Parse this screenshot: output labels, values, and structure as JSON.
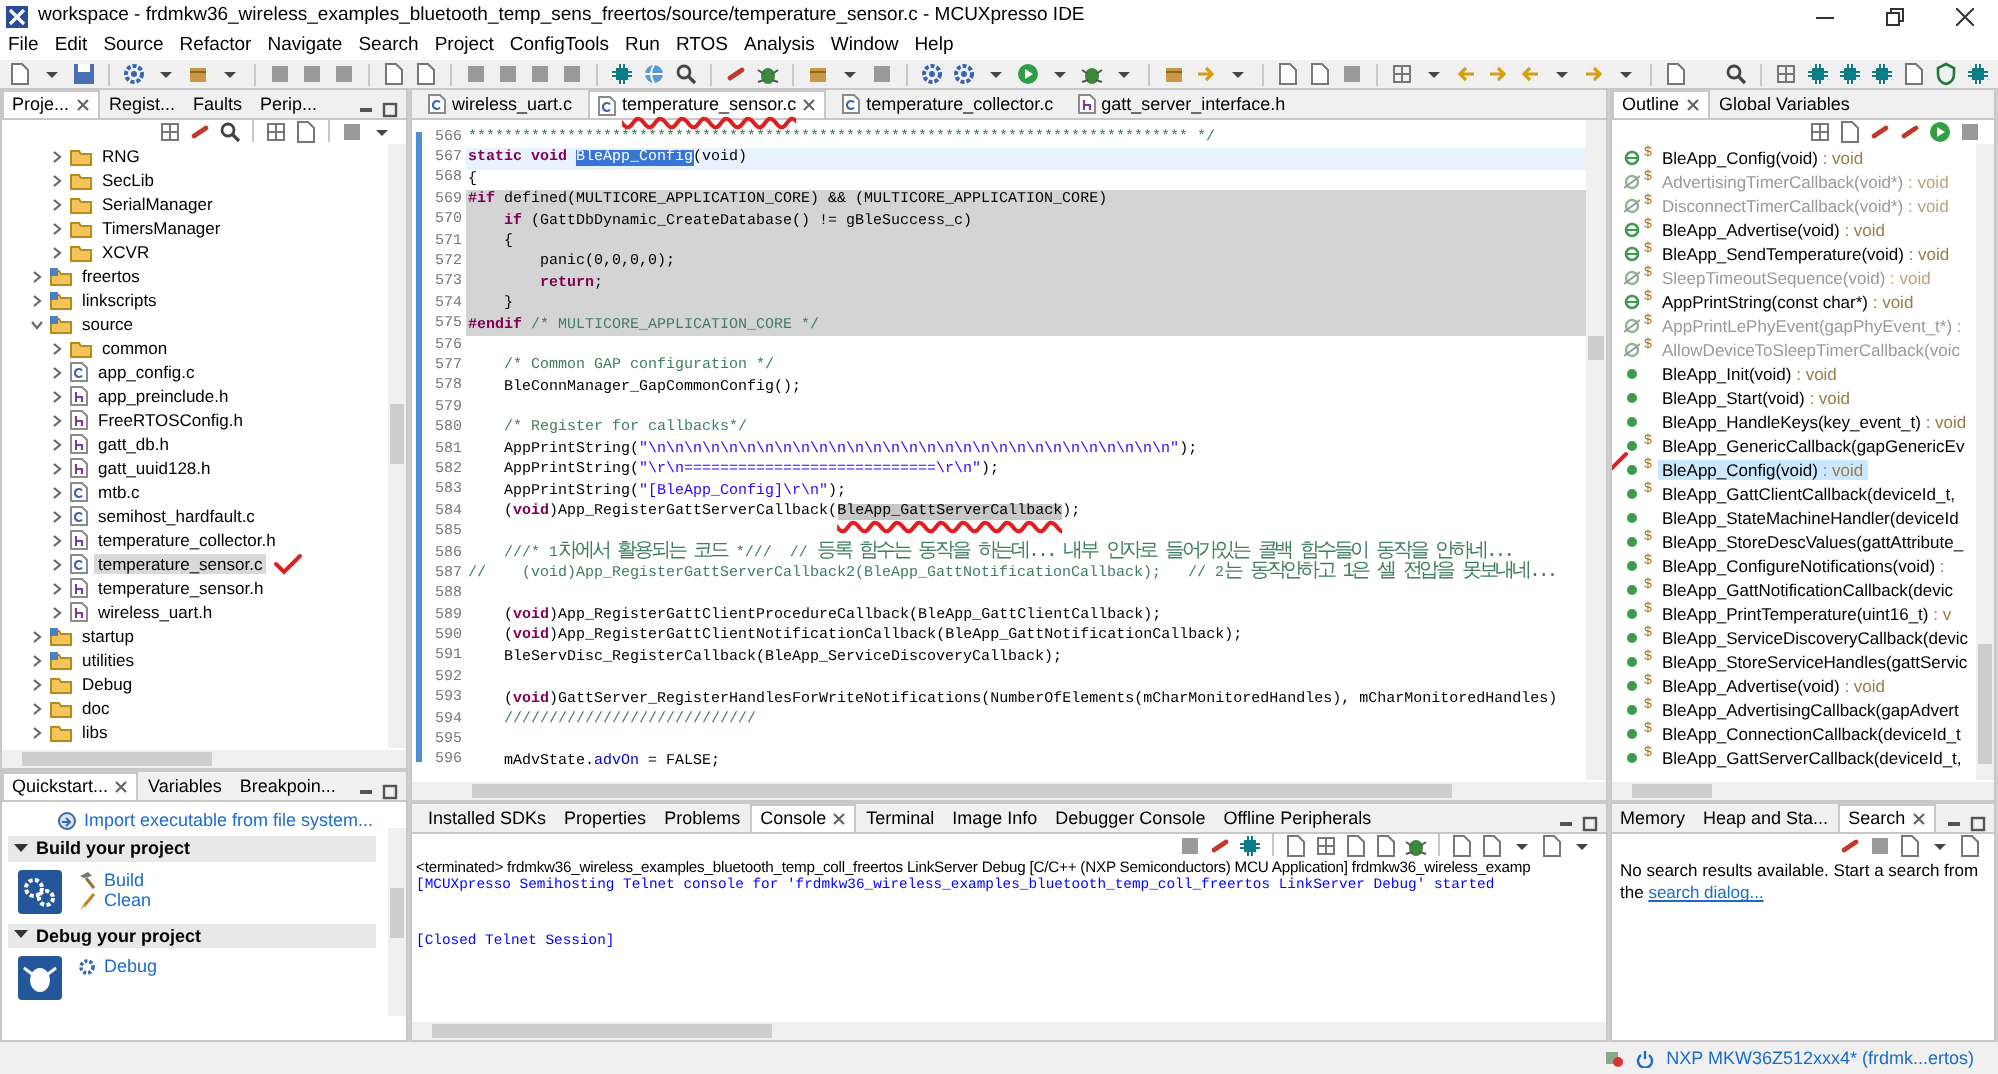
{
  "window": {
    "title": "workspace - frdmkw36_wireless_examples_bluetooth_temp_sens_freertos/source/temperature_sensor.c - MCUXpresso IDE"
  },
  "menu": [
    "File",
    "Edit",
    "Source",
    "Refactor",
    "Navigate",
    "Search",
    "Project",
    "ConfigTools",
    "Run",
    "RTOS",
    "Analysis",
    "Window",
    "Help"
  ],
  "project_panel": {
    "tabs": [
      {
        "label": "Proje...",
        "selected": true
      },
      {
        "label": "Regist...",
        "selected": false
      },
      {
        "label": "Faults",
        "selected": false
      },
      {
        "label": "Perip...",
        "selected": false
      }
    ],
    "tree": {
      "continued_children": [
        {
          "label": "RNG",
          "kind": "folder",
          "expanded": false,
          "selected": false
        },
        {
          "label": "SecLib",
          "kind": "folder",
          "expanded": false,
          "selected": false
        },
        {
          "label": "SerialManager",
          "kind": "folder",
          "expanded": false,
          "selected": false
        },
        {
          "label": "TimersManager",
          "kind": "folder",
          "expanded": false,
          "selected": false
        },
        {
          "label": "XCVR",
          "kind": "folder",
          "expanded": false,
          "selected": false
        }
      ],
      "items": [
        {
          "label": "freertos",
          "kind": "source-folder",
          "expanded": false,
          "selected": false
        },
        {
          "label": "linkscripts",
          "kind": "source-folder",
          "expanded": false,
          "selected": false
        },
        {
          "label": "source",
          "kind": "source-folder",
          "expanded": true,
          "selected": false,
          "children": [
            {
              "label": "common",
              "kind": "folder",
              "expanded": false,
              "selected": false
            },
            {
              "label": "app_config.c",
              "kind": "c-file",
              "expanded": false,
              "selected": false
            },
            {
              "label": "app_preinclude.h",
              "kind": "h-file",
              "expanded": false,
              "selected": false
            },
            {
              "label": "FreeRTOSConfig.h",
              "kind": "h-file",
              "expanded": false,
              "selected": false
            },
            {
              "label": "gatt_db.h",
              "kind": "h-file",
              "expanded": false,
              "selected": false
            },
            {
              "label": "gatt_uuid128.h",
              "kind": "h-file",
              "expanded": false,
              "selected": false
            },
            {
              "label": "mtb.c",
              "kind": "c-file",
              "expanded": false,
              "selected": false
            },
            {
              "label": "semihost_hardfault.c",
              "kind": "c-file",
              "expanded": false,
              "selected": false
            },
            {
              "label": "temperature_collector.h",
              "kind": "h-file",
              "expanded": false,
              "selected": false
            },
            {
              "label": "temperature_sensor.c",
              "kind": "c-file",
              "expanded": false,
              "selected": true,
              "annotated": true
            },
            {
              "label": "temperature_sensor.h",
              "kind": "h-file",
              "expanded": false,
              "selected": false
            },
            {
              "label": "wireless_uart.h",
              "kind": "h-file",
              "expanded": false,
              "selected": false
            }
          ]
        },
        {
          "label": "startup",
          "kind": "source-folder",
          "expanded": false,
          "selected": false
        },
        {
          "label": "utilities",
          "kind": "source-folder",
          "expanded": false,
          "selected": false
        },
        {
          "label": "Debug",
          "kind": "folder",
          "expanded": false,
          "selected": false
        },
        {
          "label": "doc",
          "kind": "folder",
          "expanded": false,
          "selected": false
        },
        {
          "label": "libs",
          "kind": "folder",
          "expanded": false,
          "selected": false
        }
      ]
    }
  },
  "quickstart_panel": {
    "tabs": [
      {
        "label": "Quickstart...",
        "selected": true
      },
      {
        "label": "Variables",
        "selected": false
      },
      {
        "label": "Breakpoin...",
        "selected": false
      }
    ],
    "import_link": "Import executable from file system...",
    "sections": [
      {
        "title": "Build your project",
        "expanded": true,
        "links": [
          "Build",
          "Clean"
        ]
      },
      {
        "title": "Debug your project",
        "expanded": true,
        "links": [
          "Debug"
        ]
      }
    ]
  },
  "editor": {
    "tabs": [
      {
        "label": "wireless_uart.c",
        "kind": "c-file",
        "selected": false
      },
      {
        "label": "temperature_sensor.c",
        "kind": "c-file",
        "selected": true,
        "annotated": true
      },
      {
        "label": "temperature_collector.c",
        "kind": "c-file",
        "selected": false
      },
      {
        "label": "gatt_server_interface.h",
        "kind": "h-file",
        "selected": false
      }
    ],
    "lines": [
      {
        "n": "566",
        "kind": "normal",
        "parts": [
          {
            "kind": "comment",
            "text": "******************************************************************************** */"
          }
        ]
      },
      {
        "n": "567",
        "kind": "current",
        "parts": [
          {
            "kind": "keyword",
            "text": "static void "
          },
          {
            "kind": "selection",
            "text": "BleApp_Config"
          },
          {
            "kind": "plain",
            "text": "(void)"
          }
        ]
      },
      {
        "n": "568",
        "kind": "normal",
        "parts": [
          {
            "kind": "plain",
            "text": "{"
          }
        ]
      },
      {
        "n": "569",
        "kind": "inactive",
        "parts": [
          {
            "kind": "keyword",
            "text": "#if "
          },
          {
            "kind": "plain",
            "text": "defined(MULTICORE_APPLICATION_CORE) && (MULTICORE_APPLICATION_CORE)"
          }
        ]
      },
      {
        "n": "570",
        "kind": "inactive",
        "parts": [
          {
            "kind": "keyword",
            "text": "    if"
          },
          {
            "kind": "plain",
            "text": " (GattDbDynamic_CreateDatabase() != gBleSuccess_c)"
          }
        ]
      },
      {
        "n": "571",
        "kind": "inactive",
        "parts": [
          {
            "kind": "plain",
            "text": "    {"
          }
        ]
      },
      {
        "n": "572",
        "kind": "inactive",
        "parts": [
          {
            "kind": "plain",
            "text": "        panic(0,0,0,0);"
          }
        ]
      },
      {
        "n": "573",
        "kind": "inactive",
        "parts": [
          {
            "kind": "keyword",
            "text": "        return"
          },
          {
            "kind": "plain",
            "text": ";"
          }
        ]
      },
      {
        "n": "574",
        "kind": "inactive",
        "parts": [
          {
            "kind": "plain",
            "text": "    }"
          }
        ]
      },
      {
        "n": "575",
        "kind": "inactive",
        "parts": [
          {
            "kind": "keyword",
            "text": "#endif "
          },
          {
            "kind": "comment",
            "text": "/* MULTICORE_APPLICATION_CORE */"
          }
        ]
      },
      {
        "n": "576",
        "kind": "normal"
      },
      {
        "n": "577",
        "kind": "normal",
        "parts": [
          {
            "kind": "comment",
            "text": "    /* Common GAP configuration */"
          }
        ]
      },
      {
        "n": "578",
        "kind": "normal",
        "parts": [
          {
            "kind": "plain",
            "text": "    BleConnManager_GapCommonConfig();"
          }
        ]
      },
      {
        "n": "579",
        "kind": "normal"
      },
      {
        "n": "580",
        "kind": "normal",
        "parts": [
          {
            "kind": "comment",
            "text": "    /* Register for callbacks*/"
          }
        ]
      },
      {
        "n": "581",
        "kind": "normal",
        "parts": [
          {
            "kind": "plain",
            "text": "    AppPrintString("
          },
          {
            "kind": "string",
            "text": "\"\\n\\n\\n\\n\\n\\n\\n\\n\\n\\n\\n\\n\\n\\n\\n\\n\\n\\n\\n\\n\\n\\n\\n\\n\\n\\n\\n\\n\\n\""
          },
          {
            "kind": "plain",
            "text": ");"
          }
        ]
      },
      {
        "n": "582",
        "kind": "normal",
        "parts": [
          {
            "kind": "plain",
            "text": "    AppPrintString("
          },
          {
            "kind": "string",
            "text": "\"\\r\\n============================\\r\\n\""
          },
          {
            "kind": "plain",
            "text": ");"
          }
        ]
      },
      {
        "n": "583",
        "kind": "normal",
        "parts": [
          {
            "kind": "plain",
            "text": "    AppPrintString("
          },
          {
            "kind": "string",
            "text": "\"[BleApp_Config]\\r\\n\""
          },
          {
            "kind": "plain",
            "text": ");"
          }
        ]
      },
      {
        "n": "584",
        "kind": "normal",
        "parts": [
          {
            "kind": "plain",
            "text": "    ("
          },
          {
            "kind": "keyword",
            "text": "void"
          },
          {
            "kind": "plain",
            "text": ")App_RegisterGattServerCallback("
          },
          {
            "kind": "occurrence",
            "text": "BleApp_GattServerCallback",
            "annotated": true
          },
          {
            "kind": "plain",
            "text": ");"
          }
        ]
      },
      {
        "n": "585",
        "kind": "normal"
      },
      {
        "n": "586",
        "kind": "normal",
        "parts": [
          {
            "kind": "comment",
            "text": "    ///* 1"
          },
          {
            "kind": "hangul",
            "text": "차에서 활용되는 코드"
          },
          {
            "kind": "comment",
            "text": " *///  // "
          },
          {
            "kind": "hangul",
            "text": "등록 함수는 동작을 하는데... 내부 인자로 들어가있는 콜백 함수들이 동작을 안하네..."
          }
        ]
      },
      {
        "n": "587",
        "kind": "normal",
        "parts": [
          {
            "kind": "comment",
            "text": "//    (void)App_RegisterGattServerCallback2(BleApp_GattNotificationCallback);   // 2"
          },
          {
            "kind": "hangul",
            "text": "는 동작안하고 1은 셀 전압을 못보내네..."
          }
        ]
      },
      {
        "n": "588",
        "kind": "normal"
      },
      {
        "n": "589",
        "kind": "normal",
        "parts": [
          {
            "kind": "plain",
            "text": "    ("
          },
          {
            "kind": "keyword",
            "text": "void"
          },
          {
            "kind": "plain",
            "text": ")App_RegisterGattClientProcedureCallback(BleApp_GattClientCallback);"
          }
        ]
      },
      {
        "n": "590",
        "kind": "normal",
        "parts": [
          {
            "kind": "plain",
            "text": "    ("
          },
          {
            "kind": "keyword",
            "text": "void"
          },
          {
            "kind": "plain",
            "text": ")App_RegisterGattClientNotificationCallback(BleApp_GattNotificationCallback);"
          }
        ]
      },
      {
        "n": "591",
        "kind": "normal",
        "parts": [
          {
            "kind": "plain",
            "text": "    BleServDisc_RegisterCallback(BleApp_ServiceDiscoveryCallback);"
          }
        ]
      },
      {
        "n": "592",
        "kind": "normal"
      },
      {
        "n": "593",
        "kind": "normal",
        "parts": [
          {
            "kind": "plain",
            "text": "    ("
          },
          {
            "kind": "keyword",
            "text": "void"
          },
          {
            "kind": "plain",
            "text": ")GattServer_RegisterHandlesForWriteNotifications(NumberOfElements(mCharMonitoredHandles), mCharMonitoredHandles)"
          }
        ]
      },
      {
        "n": "594",
        "kind": "normal",
        "parts": [
          {
            "kind": "comment",
            "text": "    ////////////////////////////"
          }
        ]
      },
      {
        "n": "595",
        "kind": "normal"
      },
      {
        "n": "596",
        "kind": "normal",
        "parts": [
          {
            "kind": "plain",
            "text": "    mAdvState."
          },
          {
            "kind": "field",
            "text": "advOn"
          },
          {
            "kind": "plain",
            "text": " = FALSE;"
          }
        ]
      }
    ]
  },
  "console_panel": {
    "tabs": [
      {
        "label": "Installed SDKs",
        "selected": false
      },
      {
        "label": "Properties",
        "selected": false
      },
      {
        "label": "Problems",
        "selected": false
      },
      {
        "label": "Console",
        "selected": true
      },
      {
        "label": "Terminal",
        "selected": false
      },
      {
        "label": "Image Info",
        "selected": false
      },
      {
        "label": "Debugger Console",
        "selected": false
      },
      {
        "label": "Offline Peripherals",
        "selected": false
      }
    ],
    "header": "<terminated> frdmkw36_wireless_examples_bluetooth_temp_coll_freertos LinkServer Debug [C/C++ (NXP Semiconductors) MCU Application] frdmkw36_wireless_examp",
    "lines": [
      "[MCUXpresso Semihosting Telnet console for 'frdmkw36_wireless_examples_bluetooth_temp_coll_freertos LinkServer Debug' started",
      "[Closed Telnet Session]"
    ]
  },
  "outline_panel": {
    "tabs": [
      {
        "label": "Outline",
        "selected": true
      },
      {
        "label": "Global Variables",
        "selected": false
      }
    ],
    "items": [
      {
        "kind": "method",
        "static": "$",
        "name": "BleApp_Config(void)",
        "type": " : void",
        "dimmed": false,
        "selected": false
      },
      {
        "kind": "hidden",
        "static": "$",
        "name": "AdvertisingTimerCallback(void*)",
        "type": " : void",
        "dimmed": true,
        "selected": false
      },
      {
        "kind": "hidden",
        "static": "$",
        "name": "DisconnectTimerCallback(void*)",
        "type": " : void",
        "dimmed": true,
        "selected": false
      },
      {
        "kind": "method",
        "static": "$",
        "name": "BleApp_Advertise(void)",
        "type": " : void",
        "dimmed": false,
        "selected": false
      },
      {
        "kind": "method",
        "static": "$",
        "name": "BleApp_SendTemperature(void)",
        "type": " : void",
        "dimmed": false,
        "selected": false
      },
      {
        "kind": "hidden",
        "static": "$",
        "name": "SleepTimeoutSequence(void)",
        "type": " : void",
        "dimmed": true,
        "selected": false
      },
      {
        "kind": "method",
        "static": "$",
        "name": "AppPrintString(const char*)",
        "type": " : void",
        "dimmed": false,
        "selected": false
      },
      {
        "kind": "hidden",
        "static": "$",
        "name": "AppPrintLePhyEvent(gapPhyEvent_t*)",
        "type": " :",
        "dimmed": true,
        "selected": false
      },
      {
        "kind": "hidden",
        "static": "$",
        "name": "AllowDeviceToSleepTimerCallback(voic",
        "dimmed": true,
        "selected": false
      },
      {
        "kind": "dot",
        "name": "BleApp_Init(void)",
        "type": " : void",
        "dimmed": false,
        "selected": false
      },
      {
        "kind": "dot",
        "name": "BleApp_Start(void)",
        "type": " : void",
        "dimmed": false,
        "selected": false
      },
      {
        "kind": "dot",
        "name": "BleApp_HandleKeys(key_event_t)",
        "type": " : void",
        "dimmed": false,
        "selected": false
      },
      {
        "kind": "dot",
        "static": "$",
        "name": "BleApp_GenericCallback(gapGenericEv",
        "dimmed": false,
        "selected": false
      },
      {
        "kind": "dot",
        "static": "$",
        "name": "BleApp_Config(void)",
        "type": " : void",
        "dimmed": false,
        "selected": true,
        "annotated": true
      },
      {
        "kind": "dot",
        "static": "$",
        "name": "BleApp_GattClientCallback(deviceId_t,",
        "dimmed": false,
        "selected": false
      },
      {
        "kind": "dot",
        "name": "BleApp_StateMachineHandler(deviceId",
        "dimmed": false,
        "selected": false
      },
      {
        "kind": "dot",
        "static": "$",
        "name": "BleApp_StoreDescValues(gattAttribute_",
        "dimmed": false,
        "selected": false
      },
      {
        "kind": "dot",
        "static": "$",
        "name": "BleApp_ConfigureNotifications(void)",
        "type": " :",
        "dimmed": false,
        "selected": false
      },
      {
        "kind": "dot",
        "static": "$",
        "name": "BleApp_GattNotificationCallback(devic",
        "dimmed": false,
        "selected": false
      },
      {
        "kind": "dot",
        "static": "$",
        "name": "BleApp_PrintTemperature(uint16_t)",
        "type": " : v",
        "dimmed": false,
        "selected": false
      },
      {
        "kind": "dot",
        "static": "$",
        "name": "BleApp_ServiceDiscoveryCallback(devic",
        "dimmed": false,
        "selected": false
      },
      {
        "kind": "dot",
        "static": "$",
        "name": "BleApp_StoreServiceHandles(gattServic",
        "dimmed": false,
        "selected": false
      },
      {
        "kind": "dot",
        "static": "$",
        "name": "BleApp_Advertise(void)",
        "type": " : void",
        "dimmed": false,
        "selected": false
      },
      {
        "kind": "dot",
        "static": "$",
        "name": "BleApp_AdvertisingCallback(gapAdvert",
        "dimmed": false,
        "selected": false
      },
      {
        "kind": "dot",
        "static": "$",
        "name": "BleApp_ConnectionCallback(deviceId_t",
        "dimmed": false,
        "selected": false
      },
      {
        "kind": "dot",
        "static": "$",
        "name": "BleApp_GattServerCallback(deviceId_t,",
        "dimmed": false,
        "selected": false
      }
    ]
  },
  "search_panel": {
    "tabs": [
      {
        "label": "Memory",
        "selected": false
      },
      {
        "label": "Heap and Sta...",
        "selected": false
      },
      {
        "label": "Search",
        "selected": true
      }
    ],
    "message": "No search results available. Start a search from the",
    "link": "search dialog..."
  },
  "status_bar": {
    "target": "NXP MKW36Z512xxx4* (frdmk...ertos)"
  }
}
